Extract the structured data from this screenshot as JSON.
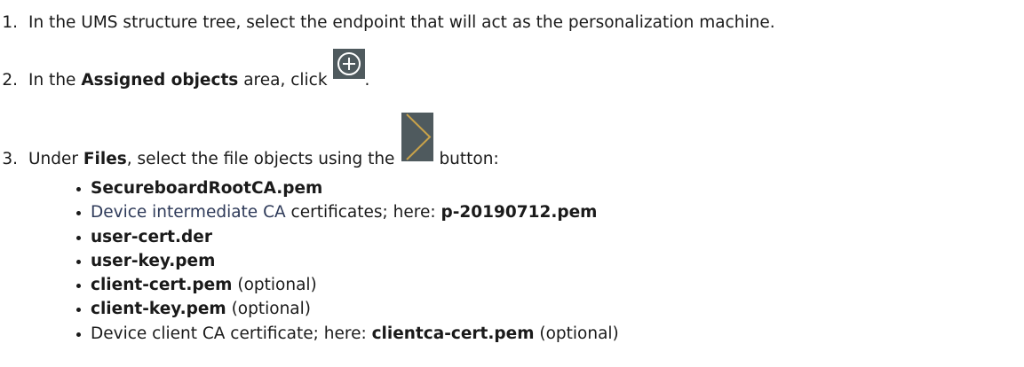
{
  "steps": [
    {
      "number": "1.",
      "text": "In the UMS structure tree, select the endpoint that will act as the personalization machine."
    },
    {
      "number": "2.",
      "text_before": "In the ",
      "bold": "Assigned objects",
      "text_middle": " area, click ",
      "icon": "add-circle-icon",
      "text_after": "."
    },
    {
      "number": "3.",
      "text_before": "Under ",
      "bold": "Files",
      "text_middle": ", select the file objects using the ",
      "icon": "chevron-right-arrow-icon",
      "text_after": " button:"
    }
  ],
  "files": [
    {
      "bold": "SecureboardRootCA.pem"
    },
    {
      "link": "Device intermediate CA",
      "text": " certificates; here: ",
      "bold": "p-20190712.pem"
    },
    {
      "bold": "user-cert.der"
    },
    {
      "bold": "user-key.pem"
    },
    {
      "bold": "client-cert.pem",
      "text": " (optional)"
    },
    {
      "bold": "client-key.pem",
      "text": " (optional)"
    },
    {
      "text_before": "Device client CA certificate; here: ",
      "bold": "clientca-cert.pem",
      "text": " (optional)"
    }
  ],
  "colors": {
    "text": "#1a1a1a",
    "link": "#2e3a59",
    "icon_bg": "#4f5a5e",
    "arrow": "#c8a24a"
  }
}
